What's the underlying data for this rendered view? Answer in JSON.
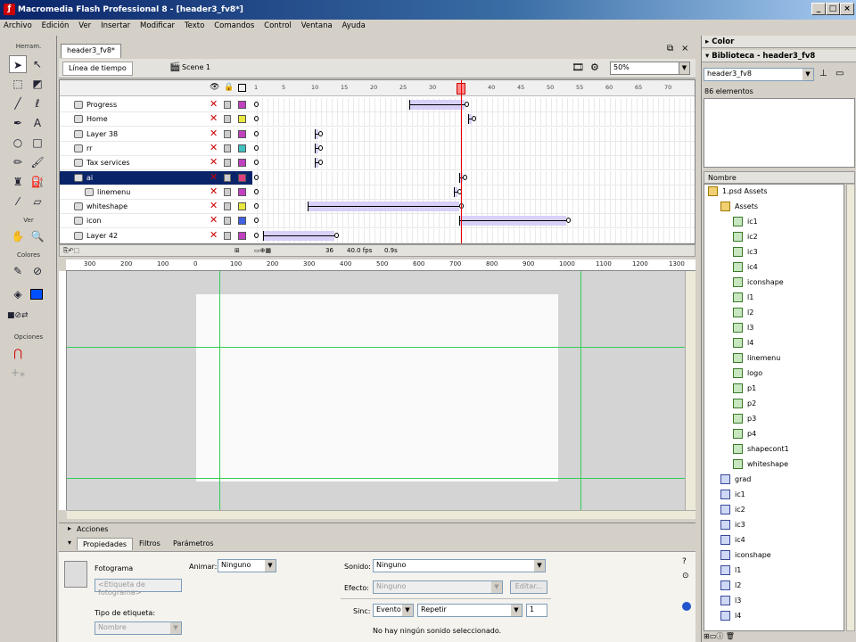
{
  "window": {
    "title": "Macromedia Flash Professional 8 - [header3_fv8*]",
    "app_icon": "flash-app-icon"
  },
  "menu": [
    "Archivo",
    "Edición",
    "Ver",
    "Insertar",
    "Modificar",
    "Texto",
    "Comandos",
    "Control",
    "Ventana",
    "Ayuda"
  ],
  "tools": {
    "herramientas_label": "Herram.",
    "ver_label": "Ver",
    "colores_label": "Colores",
    "opciones_label": "Opciones"
  },
  "document": {
    "tab": "header3_fv8*",
    "timeline_button": "Línea de tiempo",
    "scene": "Scene 1",
    "zoom": "50%"
  },
  "timeline": {
    "frame_numbers": [
      "1",
      "5",
      "10",
      "15",
      "20",
      "25",
      "30",
      "35",
      "40",
      "45",
      "50",
      "55",
      "60",
      "65",
      "70",
      "75"
    ],
    "layers": [
      {
        "name": "Progress",
        "color": "#c040c0"
      },
      {
        "name": "Home",
        "color": "#e8e840"
      },
      {
        "name": "Layer 38",
        "color": "#c040c0"
      },
      {
        "name": "rr",
        "color": "#40c0c0"
      },
      {
        "name": "Tax services",
        "color": "#c040c0"
      },
      {
        "name": "ai",
        "color": "#e04080"
      },
      {
        "name": "linemenu",
        "color": "#c040c0"
      },
      {
        "name": "whiteshape",
        "color": "#e8e840"
      },
      {
        "name": "icon",
        "color": "#4060e0"
      },
      {
        "name": "Layer 42",
        "color": "#c040c0"
      }
    ],
    "status": {
      "frame": "36",
      "fps": "40.0 fps",
      "time": "0.9s"
    }
  },
  "ruler_h": [
    "300",
    "200",
    "100",
    "0",
    "100",
    "200",
    "300",
    "400",
    "500",
    "600",
    "700",
    "800",
    "900",
    "1000",
    "1100",
    "1200",
    "1300"
  ],
  "panels": {
    "acciones": "Acciones",
    "tabs": [
      "Propiedades",
      "Filtros",
      "Parámetros"
    ],
    "fotograma_label": "Fotograma",
    "fotograma_placeholder": "<Etiqueta de fotograma>",
    "tipo_etiqueta_label": "Tipo de etiqueta:",
    "tipo_etiqueta_value": "Nombre",
    "animar_label": "Animar:",
    "animar_value": "Ninguno",
    "sonido_label": "Sonido:",
    "sonido_value": "Ninguno",
    "efecto_label": "Efecto:",
    "efecto_value": "Ninguno",
    "editar_button": "Editar...",
    "sinc_label": "Sinc:",
    "sinc_value": "Evento",
    "repetir_value": "Repetir",
    "repeat_count": "1",
    "no_sound_text": "No hay ningún sonido seleccionado."
  },
  "right": {
    "color_panel": "Color",
    "library_panel": "Biblioteca - header3_fv8",
    "library_select": "header3_fv8",
    "element_count": "86 elementos",
    "name_header": "Nombre",
    "items": [
      {
        "name": "1.psd Assets",
        "kind": "folder",
        "indent": 0
      },
      {
        "name": "Assets",
        "kind": "folder",
        "indent": 1
      },
      {
        "name": "ic1",
        "kind": "graphic",
        "indent": 2
      },
      {
        "name": "ic2",
        "kind": "graphic",
        "indent": 2
      },
      {
        "name": "ic3",
        "kind": "graphic",
        "indent": 2
      },
      {
        "name": "ic4",
        "kind": "graphic",
        "indent": 2
      },
      {
        "name": "iconshape",
        "kind": "graphic",
        "indent": 2
      },
      {
        "name": "l1",
        "kind": "graphic",
        "indent": 2
      },
      {
        "name": "l2",
        "kind": "graphic",
        "indent": 2
      },
      {
        "name": "l3",
        "kind": "graphic",
        "indent": 2
      },
      {
        "name": "l4",
        "kind": "graphic",
        "indent": 2
      },
      {
        "name": "linemenu",
        "kind": "graphic",
        "indent": 2
      },
      {
        "name": "logo",
        "kind": "graphic",
        "indent": 2
      },
      {
        "name": "p1",
        "kind": "graphic",
        "indent": 2
      },
      {
        "name": "p2",
        "kind": "graphic",
        "indent": 2
      },
      {
        "name": "p3",
        "kind": "graphic",
        "indent": 2
      },
      {
        "name": "p4",
        "kind": "graphic",
        "indent": 2
      },
      {
        "name": "shapecont1",
        "kind": "graphic",
        "indent": 2
      },
      {
        "name": "whiteshape",
        "kind": "graphic",
        "indent": 2
      },
      {
        "name": "grad",
        "kind": "movieclip",
        "indent": 1
      },
      {
        "name": "ic1",
        "kind": "movieclip",
        "indent": 1
      },
      {
        "name": "ic2",
        "kind": "movieclip",
        "indent": 1
      },
      {
        "name": "ic3",
        "kind": "movieclip",
        "indent": 1
      },
      {
        "name": "ic4",
        "kind": "movieclip",
        "indent": 1
      },
      {
        "name": "iconshape",
        "kind": "movieclip",
        "indent": 1
      },
      {
        "name": "l1",
        "kind": "movieclip",
        "indent": 1
      },
      {
        "name": "l2",
        "kind": "movieclip",
        "indent": 1
      },
      {
        "name": "l3",
        "kind": "movieclip",
        "indent": 1
      },
      {
        "name": "l4",
        "kind": "movieclip",
        "indent": 1
      }
    ]
  }
}
